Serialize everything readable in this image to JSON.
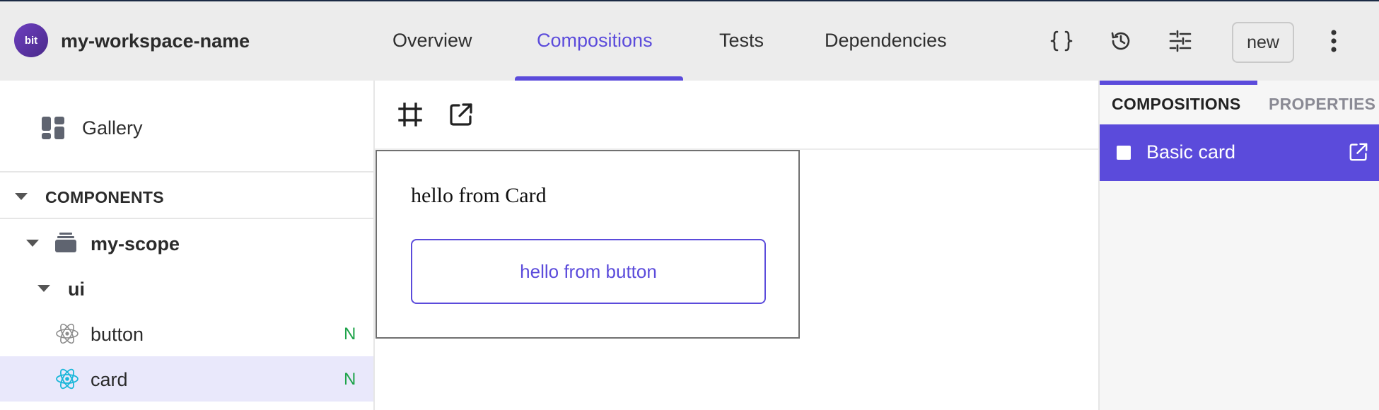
{
  "header": {
    "logo_text": "bit",
    "workspace_name": "my-workspace-name",
    "tabs": [
      {
        "label": "Overview",
        "active": false
      },
      {
        "label": "Compositions",
        "active": true
      },
      {
        "label": "Tests",
        "active": false
      },
      {
        "label": "Dependencies",
        "active": false
      }
    ],
    "icons": [
      "code-braces-icon",
      "history-icon",
      "settings-sliders-icon",
      "more-vertical-icon"
    ],
    "new_label": "new",
    "accent_color": "#5b4bdb"
  },
  "sidebar": {
    "gallery_label": "Gallery",
    "section_label": "COMPONENTS",
    "tree": [
      {
        "label": "my-scope",
        "type": "scope"
      },
      {
        "label": "ui",
        "type": "namespace"
      },
      {
        "label": "button",
        "type": "component",
        "status": "N",
        "selected": false
      },
      {
        "label": "card",
        "type": "component",
        "status": "N",
        "selected": true
      }
    ]
  },
  "preview": {
    "toolbar_icons": [
      "crop-frame-icon",
      "open-external-icon"
    ],
    "card_text": "hello from Card",
    "button_text": "hello from button"
  },
  "panel": {
    "tabs": [
      {
        "label": "COMPOSITIONS",
        "active": true
      },
      {
        "label": "PROPERTIES",
        "active": false
      }
    ],
    "items": [
      {
        "label": "Basic card",
        "selected": true
      }
    ]
  }
}
